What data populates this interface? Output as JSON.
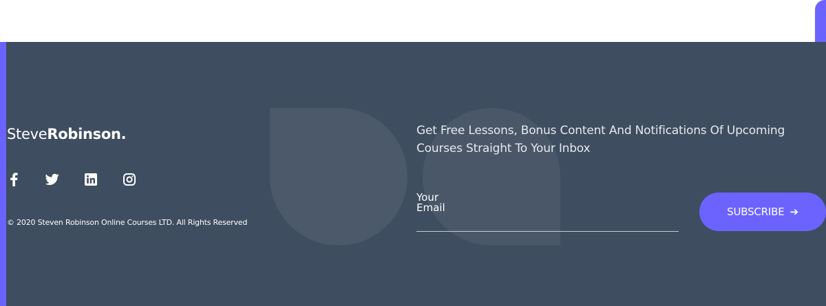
{
  "brand": {
    "name_light": "Steve",
    "name_bold": "Robinson."
  },
  "social": [
    {
      "icon": "facebook-icon",
      "glyph": "f"
    },
    {
      "icon": "twitter-icon",
      "glyph": ""
    },
    {
      "icon": "linkedin-icon",
      "glyph": "in"
    },
    {
      "icon": "instagram-icon",
      "glyph": ""
    }
  ],
  "copyright": "© 2020 Steven Robinson Online Courses LTD. All Rights Reserved",
  "newsletter": {
    "text": "Get Free Lessons, Bonus Content And Notifications Of Upcoming Courses Straight To Your Inbox",
    "email_placeholder": "Your Email",
    "button_label": "SUBSCRIBE",
    "button_icon": "arrow-right-icon"
  },
  "colors": {
    "accent": "#6c63ff",
    "footer_bg": "#3e4d5f"
  }
}
